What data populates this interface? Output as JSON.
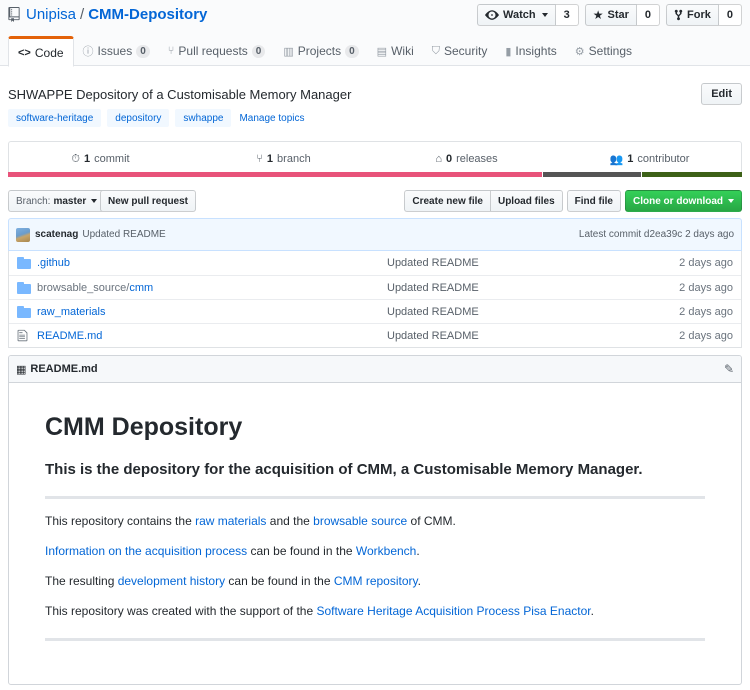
{
  "repo": {
    "owner": "Unipisa",
    "separator": "/",
    "name": "CMM-Depository"
  },
  "actions": {
    "watch_label": "Watch",
    "watch_count": "3",
    "star_label": "Star",
    "star_count": "0",
    "fork_label": "Fork",
    "fork_count": "0"
  },
  "tabs": [
    {
      "label": "Code",
      "icon": "code-icon"
    },
    {
      "label": "Issues",
      "icon": "issue-icon",
      "count": "0"
    },
    {
      "label": "Pull requests",
      "icon": "pull-request-icon",
      "count": "0"
    },
    {
      "label": "Projects",
      "icon": "project-icon",
      "count": "0"
    },
    {
      "label": "Wiki",
      "icon": "book-icon"
    },
    {
      "label": "Security",
      "icon": "shield-icon"
    },
    {
      "label": "Insights",
      "icon": "graph-icon"
    },
    {
      "label": "Settings",
      "icon": "gear-icon"
    }
  ],
  "description": "SHWAPPE Depository of a Customisable Memory Manager",
  "edit_label": "Edit",
  "topics": [
    "software-heritage",
    "depository",
    "swhappe"
  ],
  "manage_topics": "Manage topics",
  "summary": {
    "commits_num": "1",
    "commits_label": "commit",
    "branches_num": "1",
    "branches_label": "branch",
    "releases_num": "0",
    "releases_label": "releases",
    "contributors_num": "1",
    "contributors_label": "contributor"
  },
  "languages": [
    {
      "color": "#e8537a",
      "share": 0.728
    },
    {
      "color": "#555555",
      "share": 0.135
    },
    {
      "color": "#3d6117",
      "share": 0.137
    }
  ],
  "filenav": {
    "branch_prefix": "Branch:",
    "branch_name": "master",
    "new_pr": "New pull request",
    "create_file": "Create new file",
    "upload_files": "Upload files",
    "find_file": "Find file",
    "clone": "Clone or download"
  },
  "commit": {
    "author": "scatenag",
    "message": "Updated README",
    "latest_label": "Latest commit d2ea39c 2 days ago"
  },
  "files": [
    {
      "icon": "folder-icon",
      "name": ".github",
      "name_dim": "",
      "message": "Updated README",
      "age": "2 days ago"
    },
    {
      "icon": "folder-icon",
      "name_dim": "browsable_source/",
      "name": "cmm",
      "message": "Updated README",
      "age": "2 days ago"
    },
    {
      "icon": "folder-icon",
      "name": "raw_materials",
      "name_dim": "",
      "message": "Updated README",
      "age": "2 days ago"
    },
    {
      "icon": "file-icon",
      "name": "README.md",
      "name_dim": "",
      "message": "Updated README",
      "age": "2 days ago"
    }
  ],
  "readme": {
    "filename": "README.md",
    "h1": "CMM Depository",
    "h3": "This is the depository for the acquisition of CMM, a Customisable Memory Manager.",
    "p1_a": "This repository contains the ",
    "p1_link1": "raw materials",
    "p1_b": " and the ",
    "p1_link2": "browsable source",
    "p1_c": " of CMM.",
    "p2_link1": "Information on the acquisition process",
    "p2_a": " can be found in the ",
    "p2_link2": "Workbench",
    "p2_b": ".",
    "p3_a": "The resulting ",
    "p3_link1": "development history",
    "p3_b": " can be found in the ",
    "p3_link2": "CMM repository",
    "p3_c": ".",
    "p4_a": "This repository was created with the support of the ",
    "p4_link1": "Software Heritage Acquisition Process Pisa Enactor",
    "p4_b": "."
  }
}
